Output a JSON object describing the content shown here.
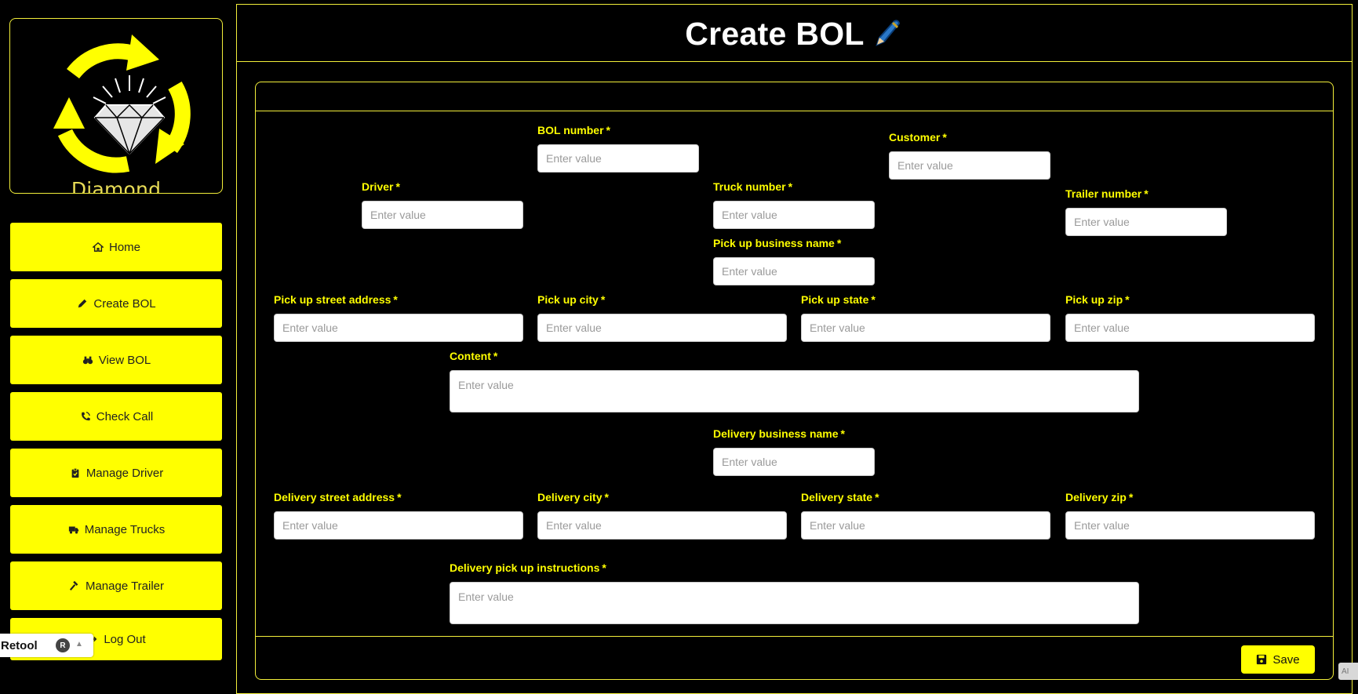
{
  "sidebar": {
    "logo_text": "Diamond Distribution",
    "items": [
      {
        "label": "Home",
        "icon": "home-icon"
      },
      {
        "label": "Create BOL",
        "icon": "pencil-icon"
      },
      {
        "label": "View BOL",
        "icon": "binoculars-icon"
      },
      {
        "label": "Check Call",
        "icon": "phone-call-icon"
      },
      {
        "label": "Manage Driver",
        "icon": "clipboard-check-icon"
      },
      {
        "label": "Manage Trucks",
        "icon": "truck-icon"
      },
      {
        "label": "Manage Trailer",
        "icon": "hammer-icon"
      },
      {
        "label": "Log Out",
        "icon": "sign-out-icon"
      }
    ]
  },
  "retool_badge": {
    "label": "Retool",
    "avatar_initial": "R"
  },
  "header": {
    "title": "Create BOL",
    "icon": "pen-icon"
  },
  "form": {
    "placeholder": "Enter value",
    "required_mark": "*",
    "fields": {
      "bol_number": "BOL number",
      "customer": "Customer",
      "driver": "Driver",
      "truck_number": "Truck number",
      "trailer_number": "Trailer number",
      "pickup_business_name": "Pick up business name",
      "pickup_street_address": "Pick up street address",
      "pickup_city": "Pick up city",
      "pickup_state": "Pick up state",
      "pickup_zip": "Pick up zip",
      "content": "Content",
      "delivery_business_name": "Delivery business name",
      "delivery_street_address": "Delivery street address",
      "delivery_city": "Delivery city",
      "delivery_state": "Delivery state",
      "delivery_zip": "Delivery zip",
      "delivery_pickup_instructions": "Delivery pick up instructions"
    },
    "save_label": "Save"
  },
  "colors": {
    "accent": "#ffff00",
    "background": "#000000",
    "border": "#f3ef3a"
  }
}
